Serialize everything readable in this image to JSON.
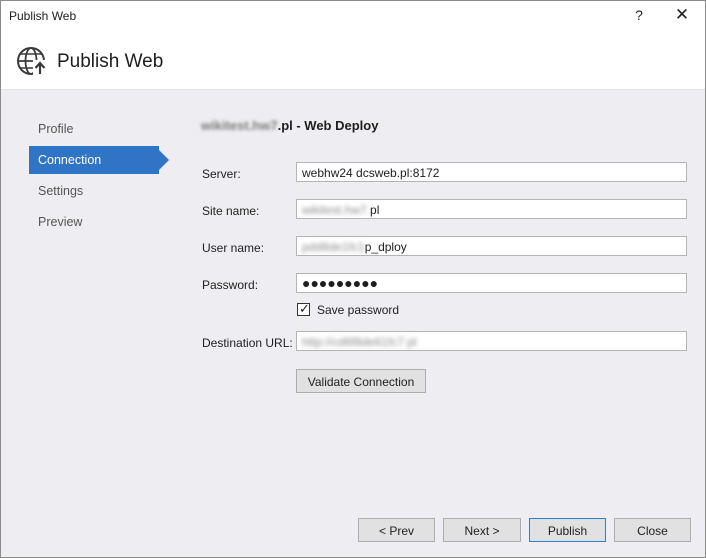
{
  "window": {
    "title": "Publish Web",
    "help_glyph": "?",
    "close_glyph": "✕"
  },
  "header": {
    "title": "Publish Web",
    "icon": "globe-upload-icon"
  },
  "nav": {
    "items": [
      {
        "label": "Profile",
        "active": false
      },
      {
        "label": "Connection",
        "active": true
      },
      {
        "label": "Settings",
        "active": false
      },
      {
        "label": "Preview",
        "active": false
      }
    ]
  },
  "profile": {
    "name_blurred": "wikitest.hw7",
    "name_suffix": ".pl - Web Deploy"
  },
  "form": {
    "server": {
      "label": "Server:",
      "value": "webhw24 dcsweb.pl:8172"
    },
    "site_name": {
      "label": "Site name:",
      "value_blurred": "wikitest.hw7.",
      "value_suffix": "pl"
    },
    "user_name": {
      "label": "User name:",
      "value_blurred": "pdd8de1fc1",
      "value_suffix": "p_dploy"
    },
    "password": {
      "label": "Password:",
      "value": "●●●●●●●●●"
    },
    "save_password": {
      "label": "Save password",
      "checked": true,
      "check_glyph": "✓"
    },
    "destination_url": {
      "label": "Destination URL:",
      "value_blurred": "http://cd6f8de61fc7.pl"
    },
    "validate_label": "Validate Connection"
  },
  "footer": {
    "prev_label": "< Prev",
    "next_label": "Next >",
    "publish_label": "Publish",
    "close_label": "Close"
  }
}
